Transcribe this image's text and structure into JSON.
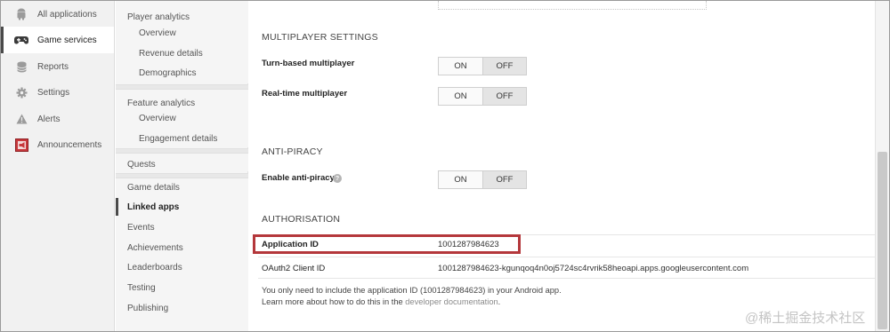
{
  "leftnav": {
    "items": [
      {
        "label": "All applications",
        "icon": "android-icon"
      },
      {
        "label": "Game services",
        "icon": "gamepad-icon",
        "active": true
      },
      {
        "label": "Reports",
        "icon": "database-icon"
      },
      {
        "label": "Settings",
        "icon": "gear-icon"
      },
      {
        "label": "Alerts",
        "icon": "warning-icon"
      },
      {
        "label": "Announcements",
        "icon": "announcement-icon"
      }
    ]
  },
  "subnav": {
    "player_analytics": "Player analytics",
    "player_overview": "Overview",
    "revenue_details": "Revenue details",
    "demographics": "Demographics",
    "feature_analytics": "Feature analytics",
    "feature_overview": "Overview",
    "engagement_details": "Engagement details",
    "quests": "Quests",
    "game_details": "Game details",
    "linked_apps": "Linked apps",
    "events": "Events",
    "achievements": "Achievements",
    "leaderboards": "Leaderboards",
    "testing": "Testing",
    "publishing": "Publishing"
  },
  "main": {
    "multiplayer": {
      "title": "MULTIPLAYER SETTINGS",
      "turn_based_label": "Turn-based multiplayer",
      "real_time_label": "Real-time multiplayer"
    },
    "anti_piracy": {
      "title": "ANTI-PIRACY",
      "enable_label": "Enable anti-piracy",
      "help_glyph": "?"
    },
    "toggle": {
      "on": "ON",
      "off": "OFF",
      "selected": "OFF"
    },
    "authorisation": {
      "title": "AUTHORISATION",
      "application_id_label": "Application ID",
      "application_id_value": "1001287984623",
      "oauth_label": "OAuth2 Client ID",
      "oauth_value": "1001287984623-kgunqoq4n0oj5724sc4rvrik58heoapi.apps.googleusercontent.com",
      "note_line1": "You only need to include the application ID (1001287984623) in your Android app.",
      "note_line2_prefix": "Learn more about how to do this in the ",
      "note_line2_link": "developer documentation",
      "note_line2_suffix": "."
    }
  },
  "colors": {
    "highlight_border": "#b4373b",
    "active_bar": "#4a4a4a"
  },
  "watermark": "@稀土掘金技术社区"
}
